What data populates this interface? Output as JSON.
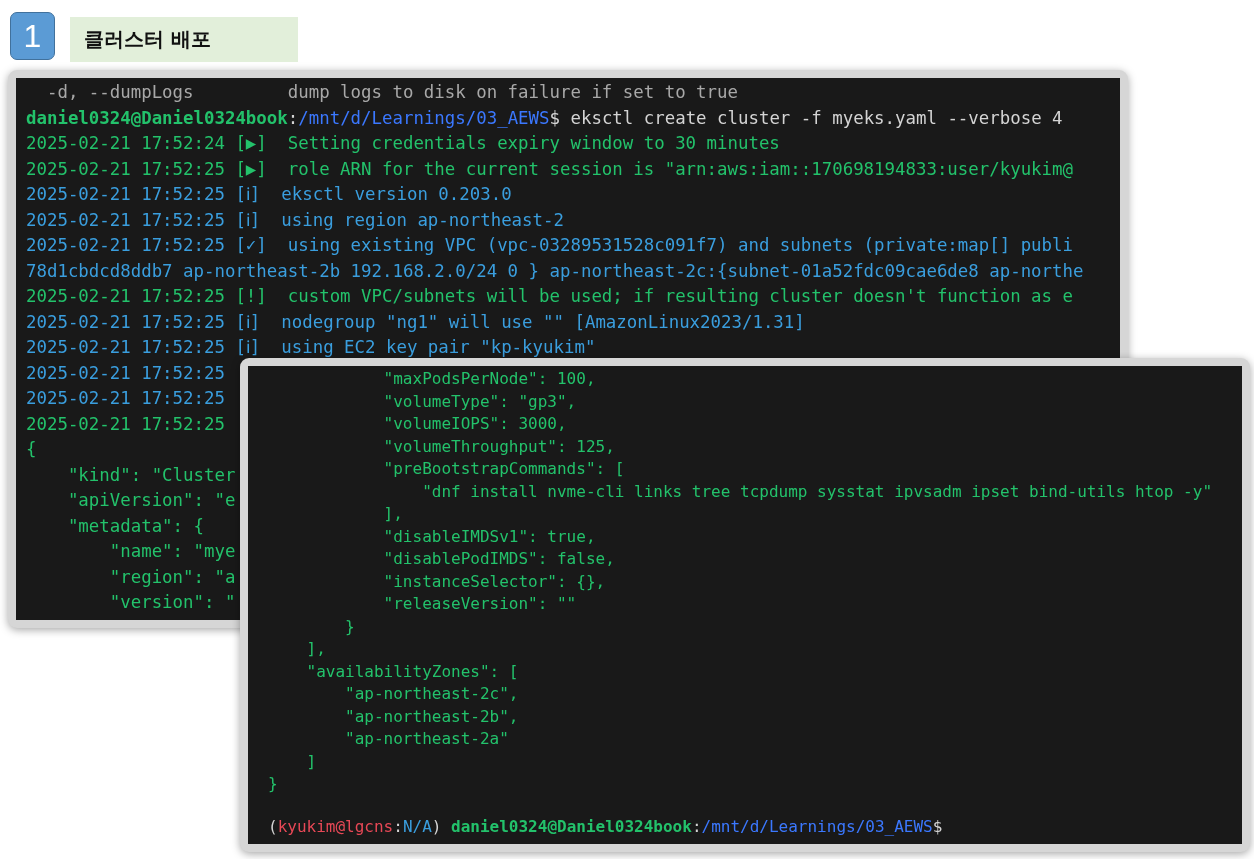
{
  "header": {
    "step": "1",
    "title": "클러스터 배포"
  },
  "terminals": [
    {
      "lines": [
        {
          "kind": "muted",
          "text": "  -d, --dumpLogs         dump logs to disk on failure if set to true"
        },
        {
          "kind": "prompt",
          "segments": [
            {
              "kind": "user",
              "text": "daniel0324@Daniel0324book"
            },
            {
              "kind": "plain",
              "text": ":"
            },
            {
              "kind": "path",
              "text": "/mnt/d/Learnings/03_AEWS"
            },
            {
              "kind": "plain",
              "text": "$ eksctl create cluster -f myeks.yaml --verbose 4"
            }
          ]
        },
        {
          "kind": "success",
          "text": "2025-02-21 17:52:24 [▶]  Setting credentials expiry window to 30 minutes"
        },
        {
          "kind": "success",
          "text": "2025-02-21 17:52:25 [▶]  role ARN for the current session is \"arn:aws:iam::170698194833:user/kyukim@"
        },
        {
          "kind": "info",
          "text": "2025-02-21 17:52:25 [ℹ]  eksctl version 0.203.0"
        },
        {
          "kind": "info",
          "text": "2025-02-21 17:52:25 [ℹ]  using region ap-northeast-2"
        },
        {
          "kind": "info",
          "text": "2025-02-21 17:52:25 [✓]  using existing VPC (vpc-03289531528c091f7) and subnets (private:map[] publi"
        },
        {
          "kind": "info",
          "text": "78d1cbdcd8ddb7 ap-northeast-2b 192.168.2.0/24 0 } ap-northeast-2c:{subnet-01a52fdc09cae6de8 ap-northe"
        },
        {
          "kind": "success",
          "text": "2025-02-21 17:52:25 [!]  custom VPC/subnets will be used; if resulting cluster doesn't function as e"
        },
        {
          "kind": "info",
          "text": "2025-02-21 17:52:25 [ℹ]  nodegroup \"ng1\" will use \"\" [AmazonLinux2023/1.31]"
        },
        {
          "kind": "info",
          "text": "2025-02-21 17:52:25 [ℹ]  using EC2 key pair \"kp-kyukim\""
        },
        {
          "kind": "info",
          "text": "2025-02-21 17:52:25"
        },
        {
          "kind": "info",
          "text": "2025-02-21 17:52:25"
        },
        {
          "kind": "success",
          "text": "2025-02-21 17:52:25"
        },
        {
          "kind": "success",
          "text": "{"
        },
        {
          "kind": "success",
          "text": "    \"kind\": \"Cluster"
        },
        {
          "kind": "success",
          "text": "    \"apiVersion\": \"e"
        },
        {
          "kind": "success",
          "text": "    \"metadata\": {"
        },
        {
          "kind": "success",
          "text": "        \"name\": \"mye"
        },
        {
          "kind": "success",
          "text": "        \"region\": \"a"
        },
        {
          "kind": "success",
          "text": "        \"version\": \""
        }
      ]
    },
    {
      "lines": [
        {
          "kind": "success",
          "text": "            \"maxPodsPerNode\": 100,"
        },
        {
          "kind": "success",
          "text": "            \"volumeType\": \"gp3\","
        },
        {
          "kind": "success",
          "text": "            \"volumeIOPS\": 3000,"
        },
        {
          "kind": "success",
          "text": "            \"volumeThroughput\": 125,"
        },
        {
          "kind": "success",
          "text": "            \"preBootstrapCommands\": ["
        },
        {
          "kind": "success",
          "text": "                \"dnf install nvme-cli links tree tcpdump sysstat ipvsadm ipset bind-utils htop -y\""
        },
        {
          "kind": "success",
          "text": "            ],"
        },
        {
          "kind": "success",
          "text": "            \"disableIMDSv1\": true,"
        },
        {
          "kind": "success",
          "text": "            \"disablePodIMDS\": false,"
        },
        {
          "kind": "success",
          "text": "            \"instanceSelector\": {},"
        },
        {
          "kind": "success",
          "text": "            \"releaseVersion\": \"\""
        },
        {
          "kind": "success",
          "text": "        }"
        },
        {
          "kind": "success",
          "text": "    ],"
        },
        {
          "kind": "success",
          "text": "    \"availabilityZones\": ["
        },
        {
          "kind": "success",
          "text": "        \"ap-northeast-2c\","
        },
        {
          "kind": "success",
          "text": "        \"ap-northeast-2b\","
        },
        {
          "kind": "success",
          "text": "        \"ap-northeast-2a\""
        },
        {
          "kind": "success",
          "text": "    ]"
        },
        {
          "kind": "success",
          "text": "}"
        },
        {
          "kind": "blank"
        },
        {
          "kind": "prompt",
          "segments": [
            {
              "kind": "plain",
              "text": "("
            },
            {
              "kind": "context",
              "text": "kyukim@lgcns"
            },
            {
              "kind": "plain",
              "text": ":"
            },
            {
              "kind": "info",
              "text": "N/A"
            },
            {
              "kind": "plain",
              "text": ") "
            },
            {
              "kind": "user",
              "text": "daniel0324@Daniel0324book"
            },
            {
              "kind": "plain",
              "text": ":"
            },
            {
              "kind": "path",
              "text": "/mnt/d/Learnings/03_AEWS"
            },
            {
              "kind": "plain",
              "text": "$"
            }
          ]
        }
      ]
    }
  ]
}
